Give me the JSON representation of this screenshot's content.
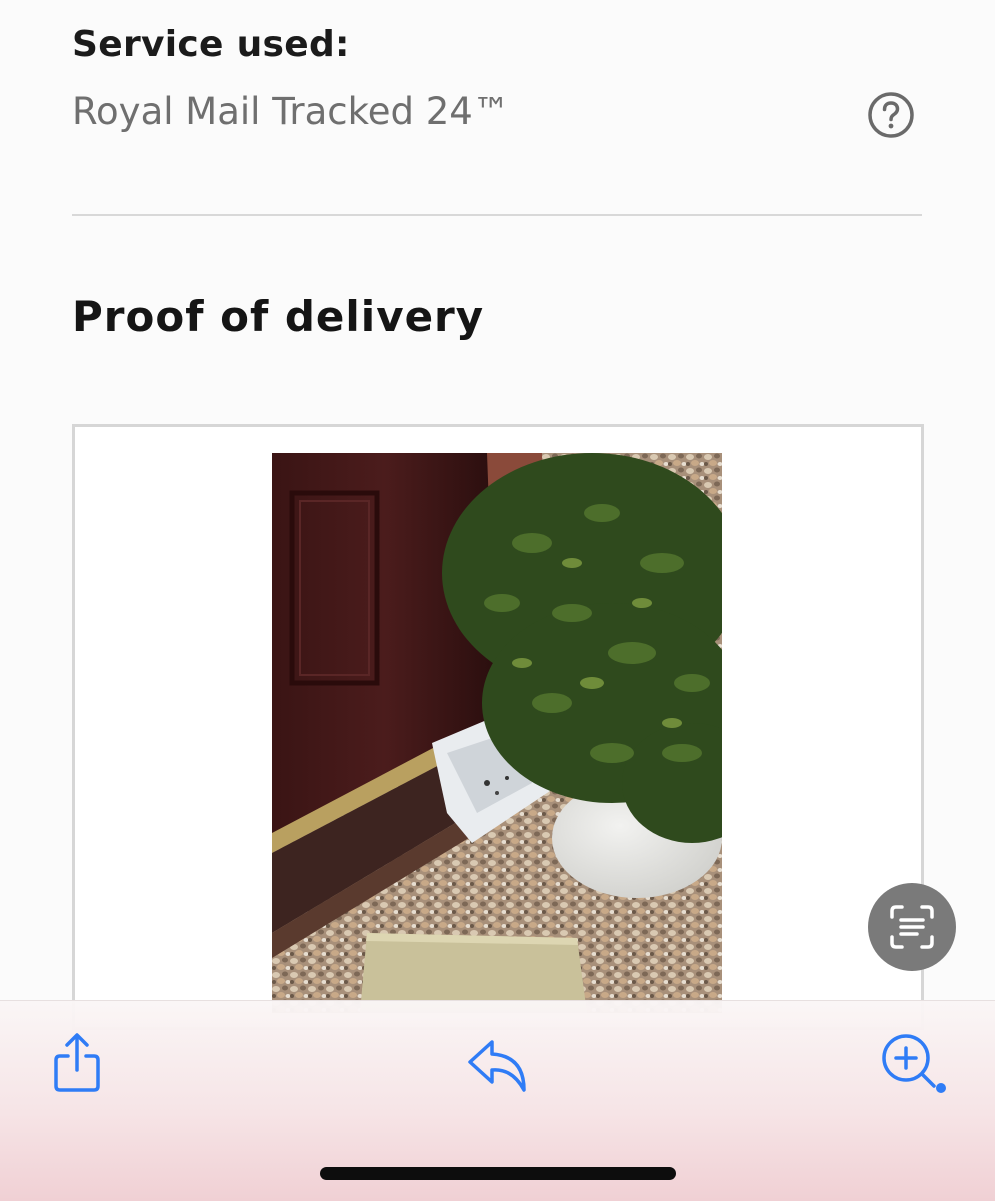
{
  "service": {
    "label": "Service used:",
    "value": "Royal Mail Tracked 24™",
    "help_icon": "question-circle-icon"
  },
  "proof": {
    "title": "Proof of delivery",
    "photo_description_icon": "delivery-photo"
  },
  "overlay": {
    "live_text_icon": "live-text-scan-icon"
  },
  "toolbar": {
    "share_icon": "share-icon",
    "reply_icon": "reply-icon",
    "zoom_icon": "zoom-in-icon"
  },
  "colors": {
    "accent": "#2f7cf6",
    "text_primary": "#1b1b1b",
    "text_secondary": "#6f6f6f",
    "divider": "#d8d8d8"
  }
}
